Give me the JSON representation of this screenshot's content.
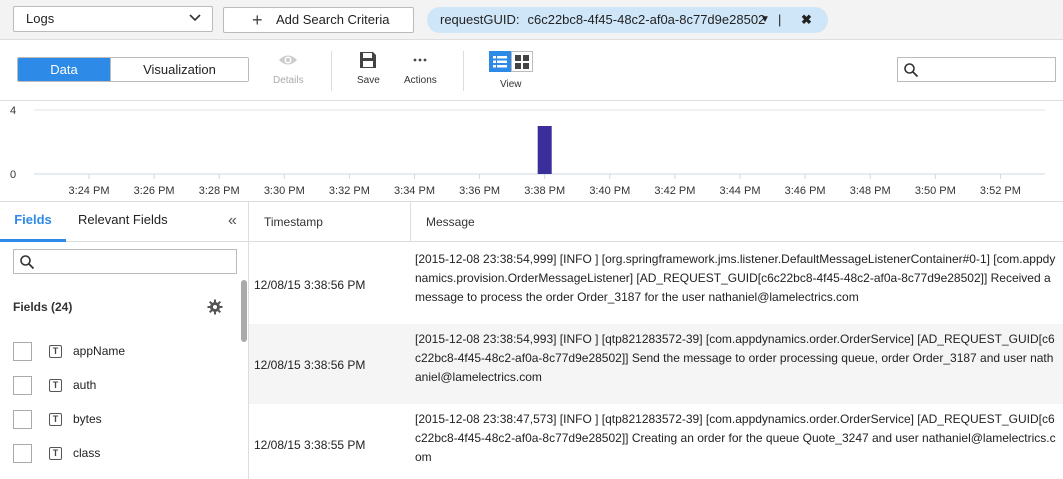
{
  "search": {
    "source": "Logs",
    "add_criteria": "Add Search Criteria",
    "criteria_key": "requestGUID:",
    "criteria_value": "c6c22bc8-4f45-48c2-af0a-8c77d9e28502",
    "criteria_sep": "|",
    "criteria_remove": "✖"
  },
  "toolbar": {
    "tab_data": "Data",
    "tab_visualization": "Visualization",
    "details": "Details",
    "save": "Save",
    "actions": "Actions",
    "view": "View"
  },
  "chart_data": {
    "type": "bar",
    "y_ticks": [
      "4",
      "0"
    ],
    "ylim": [
      0,
      4
    ],
    "categories": [
      "3:24 PM",
      "3:26 PM",
      "3:28 PM",
      "3:30 PM",
      "3:32 PM",
      "3:34 PM",
      "3:36 PM",
      "3:38 PM",
      "3:40 PM",
      "3:42 PM",
      "3:44 PM",
      "3:46 PM",
      "3:48 PM",
      "3:50 PM",
      "3:52 PM"
    ],
    "values": [
      0,
      0,
      0,
      0,
      0,
      0,
      0,
      3,
      0,
      0,
      0,
      0,
      0,
      0,
      0
    ],
    "bar_color": "#3a2e9a",
    "grid": true
  },
  "fields_panel": {
    "tab_fields": "Fields",
    "tab_relevant": "Relevant Fields",
    "collapse": "«",
    "header": "Fields (24)",
    "items": [
      "appName",
      "auth",
      "bytes",
      "class"
    ]
  },
  "table": {
    "col_timestamp": "Timestamp",
    "col_message": "Message",
    "rows": [
      {
        "timestamp": "12/08/15 3:38:56 PM",
        "message": "[2015-12-08 23:38:54,999] [INFO ] [org.springframework.jms.listener.DefaultMessageListenerContainer#0-1] [com.appdynamics.provision.OrderMessageListener] [AD_REQUEST_GUID[c6c22bc8-4f45-48c2-af0a-8c77d9e28502]] Received a message to process the order Order_3187 for the user nathaniel@lamelectrics.com"
      },
      {
        "timestamp": "12/08/15 3:38:56 PM",
        "message": "[2015-12-08 23:38:54,993] [INFO ] [qtp821283572-39] [com.appdynamics.order.OrderService] [AD_REQUEST_GUID[c6c22bc8-4f45-48c2-af0a-8c77d9e28502]] Send the message to order processing queue, order Order_3187 and user nathaniel@lamelectrics.com"
      },
      {
        "timestamp": "12/08/15 3:38:55 PM",
        "message": "[2015-12-08 23:38:47,573] [INFO ] [qtp821283572-39] [com.appdynamics.order.OrderService] [AD_REQUEST_GUID[c6c22bc8-4f45-48c2-af0a-8c77d9e28502]] Creating an order for the queue Quote_3247 and user nathaniel@lamelectrics.com"
      }
    ]
  }
}
